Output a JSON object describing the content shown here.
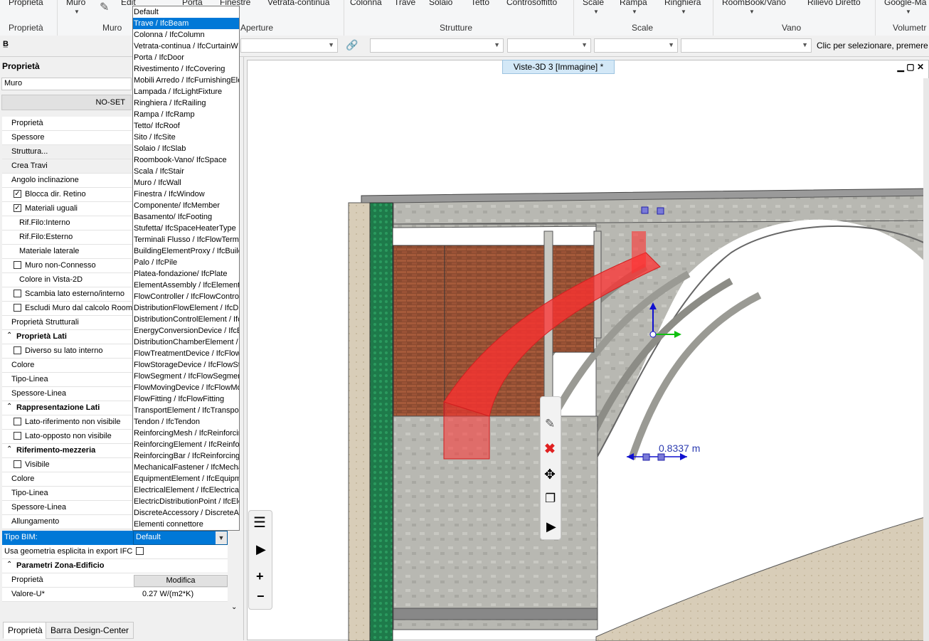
{
  "ribbon": {
    "buttons": [
      "Proprietà",
      "Muro",
      "Edit",
      "Porta",
      "Finestre",
      "Vetrata-continua",
      "Colonna",
      "Trave",
      "Solaio",
      "Tetto",
      "Controsoffitto",
      "Scale",
      "Rampa",
      "Ringhiera",
      "RoomBook/Vano",
      "Rilievo Diretto",
      "Google-Ma"
    ],
    "groups": [
      "Proprietà",
      "Muro",
      "Aperture",
      "Strutture",
      "Scale",
      "Vano",
      "Volumetr"
    ]
  },
  "toolbar": {
    "status_hint": "Clic per selezionare, premere M"
  },
  "panel": {
    "title": "Proprietà",
    "element_name": "Muro",
    "noset_label": "NO-SET",
    "rows": [
      {
        "label": "Proprietà",
        "type": "plain"
      },
      {
        "label": "Spessore",
        "type": "plain"
      },
      {
        "label": "Struttura...",
        "type": "button"
      },
      {
        "label": "Crea Travi",
        "type": "button"
      },
      {
        "label": "Angolo inclinazione",
        "type": "plain"
      },
      {
        "label": "Blocca dir. Retino",
        "type": "check",
        "checked": true
      },
      {
        "label": "Materiali uguali",
        "type": "check",
        "checked": true
      },
      {
        "label": "Rif.Filo:Interno",
        "type": "indent"
      },
      {
        "label": "Rif.Filo:Esterno",
        "type": "indent"
      },
      {
        "label": "Materiale laterale",
        "type": "indent"
      },
      {
        "label": "Muro non-Connesso",
        "type": "check",
        "checked": false
      },
      {
        "label": "Colore in Vista-2D",
        "type": "indent"
      },
      {
        "label": "Scambia lato esterno/interno",
        "type": "check",
        "checked": false
      },
      {
        "label": "Escludi Muro dal calcolo Roombo",
        "type": "check",
        "checked": false
      },
      {
        "label": "Proprietà Strutturali",
        "type": "plain"
      },
      {
        "label": "Proprietà Lati",
        "type": "section"
      },
      {
        "label": "Diverso su lato interno",
        "type": "check",
        "checked": false
      },
      {
        "label": "Colore",
        "type": "plain"
      },
      {
        "label": "Tipo-Linea",
        "type": "plain"
      },
      {
        "label": "Spessore-Linea",
        "type": "plain"
      },
      {
        "label": "Rappresentazione Lati",
        "type": "section"
      },
      {
        "label": "Lato-riferimento non visibile",
        "type": "check",
        "checked": false
      },
      {
        "label": "Lato-opposto non visibile",
        "type": "check",
        "checked": false
      },
      {
        "label": "Riferimento-mezzeria",
        "type": "section"
      },
      {
        "label": "Visibile",
        "type": "check",
        "checked": false
      },
      {
        "label": "Colore",
        "type": "plain"
      },
      {
        "label": "Tipo-Linea",
        "type": "plain"
      },
      {
        "label": "Spessore-Linea",
        "type": "plain"
      },
      {
        "label": "Allungamento",
        "type": "plain"
      }
    ],
    "tipo_bim_label": "Tipo BIM:",
    "tipo_bim_value": "Default",
    "ifc_explicit_label": "Usa geometria esplicita in export IFC",
    "zona_section": "Parametri Zona-Edificio",
    "zona_prop_label": "Proprietà",
    "modifica_label": "Modifica",
    "valore_u_label": "Valore-U*",
    "valore_u_value": "0.27 W/(m2*K)"
  },
  "dropdown": {
    "selected_index": 1,
    "items": [
      "Default",
      "Trave / IfcBeam",
      "Colonna / IfcColumn",
      "Vetrata-continua / IfcCurtainW",
      "Porta / IfcDoor",
      "Rivestimento / IfcCovering",
      "Mobili Arredo / IfcFurnishingEle",
      "Lampada / IfcLightFixture",
      "Ringhiera / IfcRailing",
      "Rampa / IfcRamp",
      "Tetto/ IfcRoof",
      "Sito / IfcSite",
      "Solaio / IfcSlab",
      "Roombook-Vano/ IfcSpace",
      "Scala / IfcStair",
      "Muro / IfcWall",
      "Finestra / IfcWindow",
      "Componente/ IfcMember",
      "Basamento/ IfcFooting",
      "Stufetta/ IfcSpaceHeaterType",
      "Terminali Flusso / IfcFlowTermin",
      "BuildingElementProxy / IfcBuildi",
      "Palo / IfcPile",
      "Platea-fondazione/ IfcPlate",
      "ElementAssembly / IfcElementA",
      "FlowController / IfcFlowControl",
      "DistributionFlowElement / IfcDis",
      "DistributionControlElement / Ifc",
      "EnergyConversionDevice / IfcE",
      "DistributionChamberElement / I",
      "FlowTreatmentDevice / IfcFlow",
      "FlowStorageDevice / IfcFlowSt",
      "FlowSegment / IfcFlowSegmen",
      "FlowMovingDevice / IfcFlowMo",
      "FlowFitting / IfcFlowFitting",
      "TransportElement / IfcTranspor",
      "Tendon / IfcTendon",
      "ReinforcingMesh / IfcReinforcin",
      "ReinforcingElement / IfcReinfor",
      "ReinforcingBar / IfcReinforcingE",
      "MechanicalFastener / IfcMecha",
      "EquipmentElement / IfcEquipme",
      "ElectricalElement / IfcElectricalE",
      "ElectricDistributionPoint / IfcEle",
      "DiscreteAccessory / DiscreteAc",
      "Elementi connettore"
    ]
  },
  "viewport": {
    "tab_title": "Viste-3D 3 [Immagine] *",
    "dimension_label": "0.8337 m"
  },
  "bottom_tabs": [
    "Proprietà",
    "Barra Design-Center"
  ],
  "colors": {
    "selection_blue": "#0078d7",
    "highlight_red": "#ff3030"
  }
}
